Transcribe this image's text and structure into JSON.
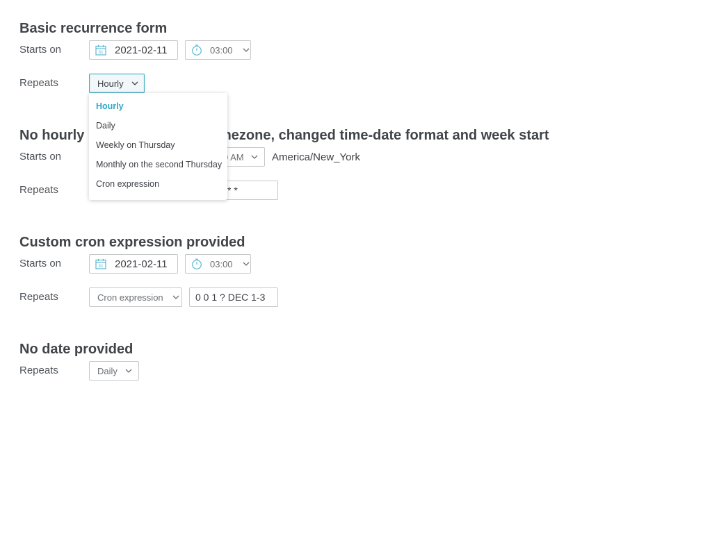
{
  "sections": [
    {
      "title": "Basic recurrence form",
      "starts_on_label": "Starts on",
      "date": "2021-02-11",
      "time": "03:00",
      "repeats_label": "Repeats",
      "repeat_value": "Hourly"
    },
    {
      "title": "No hourly option, set timezone, changed time-date format and week start",
      "title_visible": "No hourly",
      "title_visible_tail": "mezone, changed time-date format and week start",
      "starts_on_label": "Starts on",
      "time": "0 AM",
      "timezone": "America/New_York",
      "repeats_label": "Repeats",
      "cron_value": "* *"
    },
    {
      "title": "Custom cron expression provided",
      "starts_on_label": "Starts on",
      "date": "2021-02-11",
      "time": "03:00",
      "repeats_label": "Repeats",
      "repeat_value": "Cron expression",
      "cron_value": "0 0 1 ? DEC 1-3"
    },
    {
      "title": "No date provided",
      "repeats_label": "Repeats",
      "repeat_value": "Daily"
    }
  ],
  "dropdown": {
    "options": [
      "Hourly",
      "Daily",
      "Weekly on Thursday",
      "Monthly on the second Thursday",
      "Cron expression"
    ],
    "selected": "Hourly"
  },
  "colors": {
    "accent": "#2fa9c7",
    "icon": "#5cb6d1",
    "text": "#3d4045"
  },
  "icons": {
    "date": "calendar-icon",
    "time": "clock-icon",
    "select": "chevron-down-icon"
  }
}
